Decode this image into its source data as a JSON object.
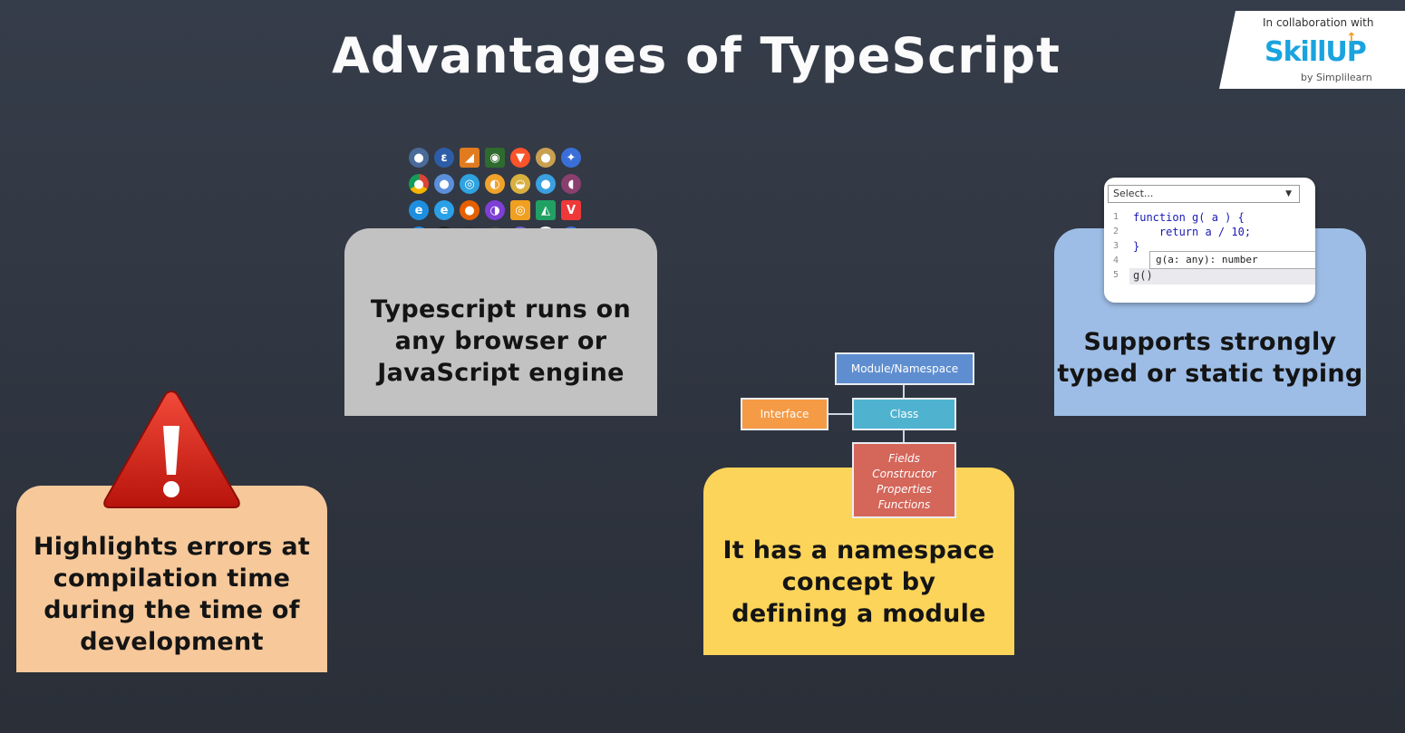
{
  "title": "Advantages of TypeScript",
  "logo": {
    "collab": "In collaboration with",
    "brand": "SkillUP",
    "by": "by Simplilearn"
  },
  "cards": {
    "errors": [
      "Highlights errors at",
      "compilation time",
      "during the time of",
      "development"
    ],
    "browser": [
      "Typescript runs on",
      "any browser or",
      "JavaScript engine"
    ],
    "namespace": [
      "It has a namespace",
      "concept by",
      "defining a module"
    ],
    "typing": [
      "Supports strongly",
      "typed or static typing"
    ]
  },
  "diagram": {
    "module": "Module/Namespace",
    "class": "Class",
    "interface": "Interface",
    "members": [
      "Fields",
      "Constructor",
      "Properties",
      "Functions"
    ]
  },
  "editor": {
    "select": "Select...",
    "lines": [
      {
        "n": "1",
        "code": "function g( a ) {"
      },
      {
        "n": "2",
        "code": "    return a / 10;"
      },
      {
        "n": "3",
        "code": "}"
      },
      {
        "n": "4",
        "code": ""
      },
      {
        "n": "5",
        "code": "g()"
      }
    ],
    "hint": "g(a: any): number"
  },
  "colors": {
    "orange_card": "#f6c89a",
    "gray_card": "#c2c2c2",
    "yellow_card": "#fcd45a",
    "blue_card": "#9dbde6",
    "brand_blue": "#1aa3df"
  },
  "icons": [
    [
      "browser-icon",
      "browser-icon",
      "browser-icon",
      "browser-icon",
      "brave-icon",
      "browser-icon",
      "browser-icon"
    ],
    [
      "chrome-icon",
      "chromium-icon",
      "browser-icon",
      "browser-icon",
      "browser-icon",
      "browser-icon",
      "browser-icon"
    ],
    [
      "edge-icon",
      "ie-icon",
      "firefox-icon",
      "browser-icon",
      "browser-icon",
      "browser-icon",
      "vivaldi-icon"
    ],
    [
      "safari-icon",
      "browser-icon",
      "browser-icon",
      "browser-icon",
      "browser-icon",
      "yandex-icon",
      "browser-icon"
    ],
    [
      "opera-icon",
      "browser-icon",
      "browser-icon",
      "browser-icon",
      "browser-icon",
      "browser-icon",
      "browser-icon"
    ]
  ]
}
